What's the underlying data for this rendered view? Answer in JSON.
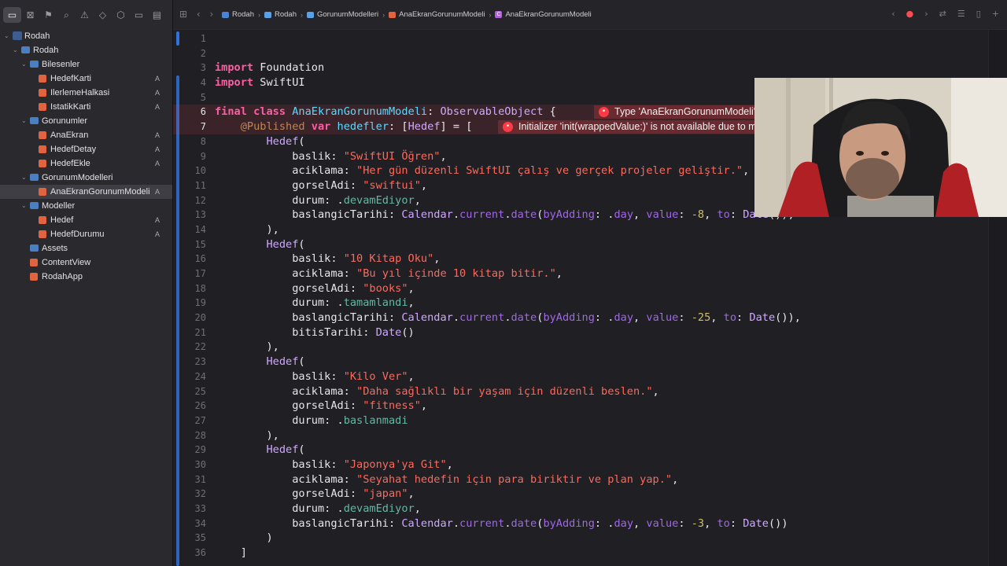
{
  "sidebar": {
    "nav_icons": [
      "folder-icon",
      "source-control-icon",
      "bookmark-icon",
      "find-icon",
      "issue-icon",
      "test-icon",
      "debug-icon",
      "breakpoint-icon",
      "report-icon"
    ],
    "tree": [
      {
        "label": "Rodah",
        "kind": "project",
        "level": 0,
        "expanded": true,
        "badge": ""
      },
      {
        "label": "Rodah",
        "kind": "folder",
        "level": 1,
        "expanded": true,
        "badge": ""
      },
      {
        "label": "Bilesenler",
        "kind": "folder",
        "level": 2,
        "expanded": true,
        "badge": ""
      },
      {
        "label": "HedefKarti",
        "kind": "swift",
        "level": 3,
        "badge": "A"
      },
      {
        "label": "IlerlemeHalkasi",
        "kind": "swift",
        "level": 3,
        "badge": "A"
      },
      {
        "label": "IstatikKarti",
        "kind": "swift",
        "level": 3,
        "badge": "A"
      },
      {
        "label": "Gorunumler",
        "kind": "folder",
        "level": 2,
        "expanded": true,
        "badge": ""
      },
      {
        "label": "AnaEkran",
        "kind": "swift",
        "level": 3,
        "badge": "A"
      },
      {
        "label": "HedefDetay",
        "kind": "swift",
        "level": 3,
        "badge": "A"
      },
      {
        "label": "HedefEkle",
        "kind": "swift",
        "level": 3,
        "badge": "A"
      },
      {
        "label": "GorunumModelleri",
        "kind": "folder",
        "level": 2,
        "expanded": true,
        "badge": ""
      },
      {
        "label": "AnaEkranGorunumModeli",
        "kind": "swift",
        "level": 3,
        "badge": "A",
        "selected": true
      },
      {
        "label": "Modeller",
        "kind": "folder",
        "level": 2,
        "expanded": true,
        "badge": ""
      },
      {
        "label": "Hedef",
        "kind": "swift",
        "level": 3,
        "badge": "A"
      },
      {
        "label": "HedefDurumu",
        "kind": "swift",
        "level": 3,
        "badge": "A"
      },
      {
        "label": "Assets",
        "kind": "assets",
        "level": 2,
        "badge": ""
      },
      {
        "label": "ContentView",
        "kind": "swift",
        "level": 2,
        "badge": ""
      },
      {
        "label": "RodahApp",
        "kind": "swift",
        "level": 2,
        "badge": ""
      }
    ]
  },
  "jumpbar": {
    "crumbs": [
      {
        "label": "Rodah",
        "icon": "project-icon"
      },
      {
        "label": "Rodah",
        "icon": "folder-icon"
      },
      {
        "label": "GorunumModelleri",
        "icon": "folder-icon"
      },
      {
        "label": "AnaEkranGorunumModeli",
        "icon": "swift-file-icon"
      },
      {
        "label": "AnaEkranGorunumModeli",
        "icon": "class-icon"
      }
    ]
  },
  "editor": {
    "errors": [
      {
        "line": 6,
        "message": "Type 'AnaEkranGorunumModeli' does not conform to protocol 'ObservableObject'"
      },
      {
        "line": 7,
        "message": "Initializer 'init(wrappedValue:)' is not available due to missing import of defining module 'Combine'"
      }
    ],
    "lines": [
      [],
      [],
      [
        [
          "kw",
          "import"
        ],
        [
          "t",
          " Foundation"
        ]
      ],
      [
        [
          "kw",
          "import"
        ],
        [
          "t",
          " SwiftUI"
        ]
      ],
      [],
      [
        [
          "kw",
          "final"
        ],
        [
          "t",
          " "
        ],
        [
          "kw",
          "class"
        ],
        [
          "t",
          " "
        ],
        [
          "decl",
          "AnaEkranGorunumModeli"
        ],
        [
          "t",
          ": "
        ],
        [
          "ty",
          "ObservableObject"
        ],
        [
          "t",
          " {"
        ]
      ],
      [
        [
          "t",
          "    "
        ],
        [
          "attr",
          "@Published"
        ],
        [
          "t",
          " "
        ],
        [
          "kw",
          "var"
        ],
        [
          "t",
          " "
        ],
        [
          "decl",
          "hedefler"
        ],
        [
          "t",
          ": ["
        ],
        [
          "ty",
          "Hedef"
        ],
        [
          "t",
          "] = ["
        ]
      ],
      [
        [
          "t",
          "        "
        ],
        [
          "ty",
          "Hedef"
        ],
        [
          "t",
          "("
        ]
      ],
      [
        [
          "t",
          "            baslik: "
        ],
        [
          "str",
          "\"SwiftUI Öğren\""
        ],
        [
          "t",
          ","
        ]
      ],
      [
        [
          "t",
          "            aciklama: "
        ],
        [
          "str",
          "\"Her gün düzenli SwiftUI çalış ve gerçek projeler geliştir.\""
        ],
        [
          "t",
          ","
        ]
      ],
      [
        [
          "t",
          "            gorselAdi: "
        ],
        [
          "str",
          "\"swiftui\""
        ],
        [
          "t",
          ","
        ]
      ],
      [
        [
          "t",
          "            durum: ."
        ],
        [
          "mem",
          "devamEdiyor"
        ],
        [
          "t",
          ","
        ]
      ],
      [
        [
          "t",
          "            baslangicTarihi: "
        ],
        [
          "ty",
          "Calendar"
        ],
        [
          "t",
          "."
        ],
        [
          "fn",
          "current"
        ],
        [
          "t",
          "."
        ],
        [
          "fn",
          "date"
        ],
        [
          "t",
          "("
        ],
        [
          "fn",
          "byAdding"
        ],
        [
          "t",
          ": ."
        ],
        [
          "fn",
          "day"
        ],
        [
          "t",
          ", "
        ],
        [
          "fn",
          "value"
        ],
        [
          "t",
          ": "
        ],
        [
          "num",
          "-8"
        ],
        [
          "t",
          ", "
        ],
        [
          "fn",
          "to"
        ],
        [
          "t",
          ": "
        ],
        [
          "ty",
          "Date"
        ],
        [
          "t",
          "()),"
        ]
      ],
      [
        [
          "t",
          "        ),"
        ]
      ],
      [
        [
          "t",
          "        "
        ],
        [
          "ty",
          "Hedef"
        ],
        [
          "t",
          "("
        ]
      ],
      [
        [
          "t",
          "            baslik: "
        ],
        [
          "str",
          "\"10 Kitap Oku\""
        ],
        [
          "t",
          ","
        ]
      ],
      [
        [
          "t",
          "            aciklama: "
        ],
        [
          "str",
          "\"Bu yıl içinde 10 kitap bitir.\""
        ],
        [
          "t",
          ","
        ]
      ],
      [
        [
          "t",
          "            gorselAdi: "
        ],
        [
          "str",
          "\"books\""
        ],
        [
          "t",
          ","
        ]
      ],
      [
        [
          "t",
          "            durum: ."
        ],
        [
          "mem",
          "tamamlandi"
        ],
        [
          "t",
          ","
        ]
      ],
      [
        [
          "t",
          "            baslangicTarihi: "
        ],
        [
          "ty",
          "Calendar"
        ],
        [
          "t",
          "."
        ],
        [
          "fn",
          "current"
        ],
        [
          "t",
          "."
        ],
        [
          "fn",
          "date"
        ],
        [
          "t",
          "("
        ],
        [
          "fn",
          "byAdding"
        ],
        [
          "t",
          ": ."
        ],
        [
          "fn",
          "day"
        ],
        [
          "t",
          ", "
        ],
        [
          "fn",
          "value"
        ],
        [
          "t",
          ": "
        ],
        [
          "num",
          "-25"
        ],
        [
          "t",
          ", "
        ],
        [
          "fn",
          "to"
        ],
        [
          "t",
          ": "
        ],
        [
          "ty",
          "Date"
        ],
        [
          "t",
          "()),"
        ]
      ],
      [
        [
          "t",
          "            bitisTarihi: "
        ],
        [
          "ty",
          "Date"
        ],
        [
          "t",
          "()"
        ]
      ],
      [
        [
          "t",
          "        ),"
        ]
      ],
      [
        [
          "t",
          "        "
        ],
        [
          "ty",
          "Hedef"
        ],
        [
          "t",
          "("
        ]
      ],
      [
        [
          "t",
          "            baslik: "
        ],
        [
          "str",
          "\"Kilo Ver\""
        ],
        [
          "t",
          ","
        ]
      ],
      [
        [
          "t",
          "            aciklama: "
        ],
        [
          "str",
          "\"Daha sağlıklı bir yaşam için düzenli beslen.\""
        ],
        [
          "t",
          ","
        ]
      ],
      [
        [
          "t",
          "            gorselAdi: "
        ],
        [
          "str",
          "\"fitness\""
        ],
        [
          "t",
          ","
        ]
      ],
      [
        [
          "t",
          "            durum: ."
        ],
        [
          "mem",
          "baslanmadi"
        ]
      ],
      [
        [
          "t",
          "        ),"
        ]
      ],
      [
        [
          "t",
          "        "
        ],
        [
          "ty",
          "Hedef"
        ],
        [
          "t",
          "("
        ]
      ],
      [
        [
          "t",
          "            baslik: "
        ],
        [
          "str",
          "\"Japonya'ya Git\""
        ],
        [
          "t",
          ","
        ]
      ],
      [
        [
          "t",
          "            aciklama: "
        ],
        [
          "str",
          "\"Seyahat hedefin için para biriktir ve plan yap.\""
        ],
        [
          "t",
          ","
        ]
      ],
      [
        [
          "t",
          "            gorselAdi: "
        ],
        [
          "str",
          "\"japan\""
        ],
        [
          "t",
          ","
        ]
      ],
      [
        [
          "t",
          "            durum: ."
        ],
        [
          "mem",
          "devamEdiyor"
        ],
        [
          "t",
          ","
        ]
      ],
      [
        [
          "t",
          "            baslangicTarihi: "
        ],
        [
          "ty",
          "Calendar"
        ],
        [
          "t",
          "."
        ],
        [
          "fn",
          "current"
        ],
        [
          "t",
          "."
        ],
        [
          "fn",
          "date"
        ],
        [
          "t",
          "("
        ],
        [
          "fn",
          "byAdding"
        ],
        [
          "t",
          ": ."
        ],
        [
          "fn",
          "day"
        ],
        [
          "t",
          ", "
        ],
        [
          "fn",
          "value"
        ],
        [
          "t",
          ": "
        ],
        [
          "num",
          "-3"
        ],
        [
          "t",
          ", "
        ],
        [
          "fn",
          "to"
        ],
        [
          "t",
          ": "
        ],
        [
          "ty",
          "Date"
        ],
        [
          "t",
          "())"
        ]
      ],
      [
        [
          "t",
          "        )"
        ]
      ],
      [
        [
          "t",
          "    ]"
        ]
      ]
    ]
  },
  "colors": {
    "keyword": "#fc5fa3",
    "string": "#fc6a5d",
    "number": "#d0bf69",
    "type": "#d0a8ff",
    "declaration": "#5dd8ff",
    "error": "#ff3b45"
  }
}
